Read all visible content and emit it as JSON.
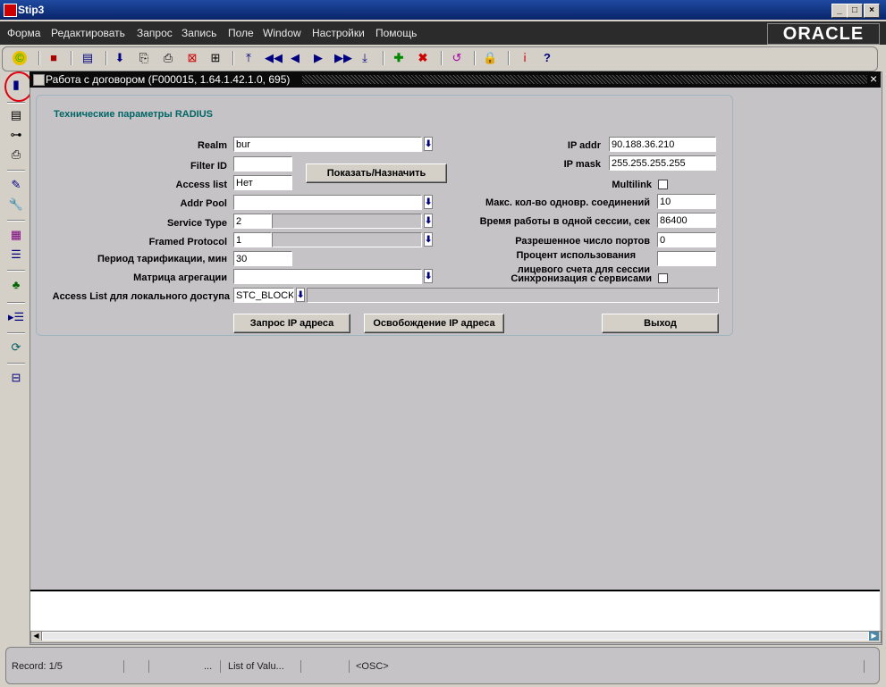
{
  "window": {
    "title": "Stip3"
  },
  "menu": [
    "Форма",
    "Редактировать",
    "Запрос",
    "Запись",
    "Поле",
    "Window",
    "Настройки",
    "Помощь"
  ],
  "brand": "ORACLE",
  "inner_window": {
    "title": "Работа с договором (F000015, 1.64.1.42.1.0, 695)"
  },
  "form": {
    "heading": "Технические параметры RADIUS",
    "realm": {
      "label": "Realm",
      "value": "bur"
    },
    "filter_id": {
      "label": "Filter ID",
      "value": ""
    },
    "access_list": {
      "label": "Access list",
      "value": "Нет"
    },
    "addr_pool": {
      "label": "Addr Pool",
      "value": ""
    },
    "service_type": {
      "label": "Service Type",
      "value": "2"
    },
    "framed_protocol": {
      "label": "Framed Protocol",
      "value": "1"
    },
    "billing_period": {
      "label": "Период тарификации, мин",
      "value": "30"
    },
    "aggregation_matrix": {
      "label": "Матрица агрегации",
      "value": ""
    },
    "local_access_list": {
      "label": "Access List для локального доступа",
      "value": "STC_BLOCK_"
    },
    "show_assign_button": "Показать/Назначить",
    "ip_addr": {
      "label": "IP addr",
      "value": "90.188.36.210"
    },
    "ip_mask": {
      "label": "IP mask",
      "value": "255.255.255.255"
    },
    "multilink": {
      "label": "Multilink"
    },
    "max_sessions": {
      "label": "Макс. кол-во одновр. соединений",
      "value": "10"
    },
    "session_time": {
      "label": "Время работы в одной сессии, сек",
      "value": "86400"
    },
    "allowed_ports": {
      "label": "Разрешенное число портов",
      "value": "0"
    },
    "usage_percent": {
      "label_line1": "Процент использования",
      "label_line2": "лицевого счета для сессии",
      "value": ""
    },
    "sync_services": {
      "label": "Синхронизация с сервисами"
    },
    "buttons": {
      "request_ip": "Запрос IP адреса",
      "release_ip": "Освобождение IP адреса",
      "exit": "Выход"
    }
  },
  "status": {
    "record": "Record: 1/5",
    "dots": "...",
    "lov": "List of Valu...",
    "osc": "<OSC>"
  }
}
